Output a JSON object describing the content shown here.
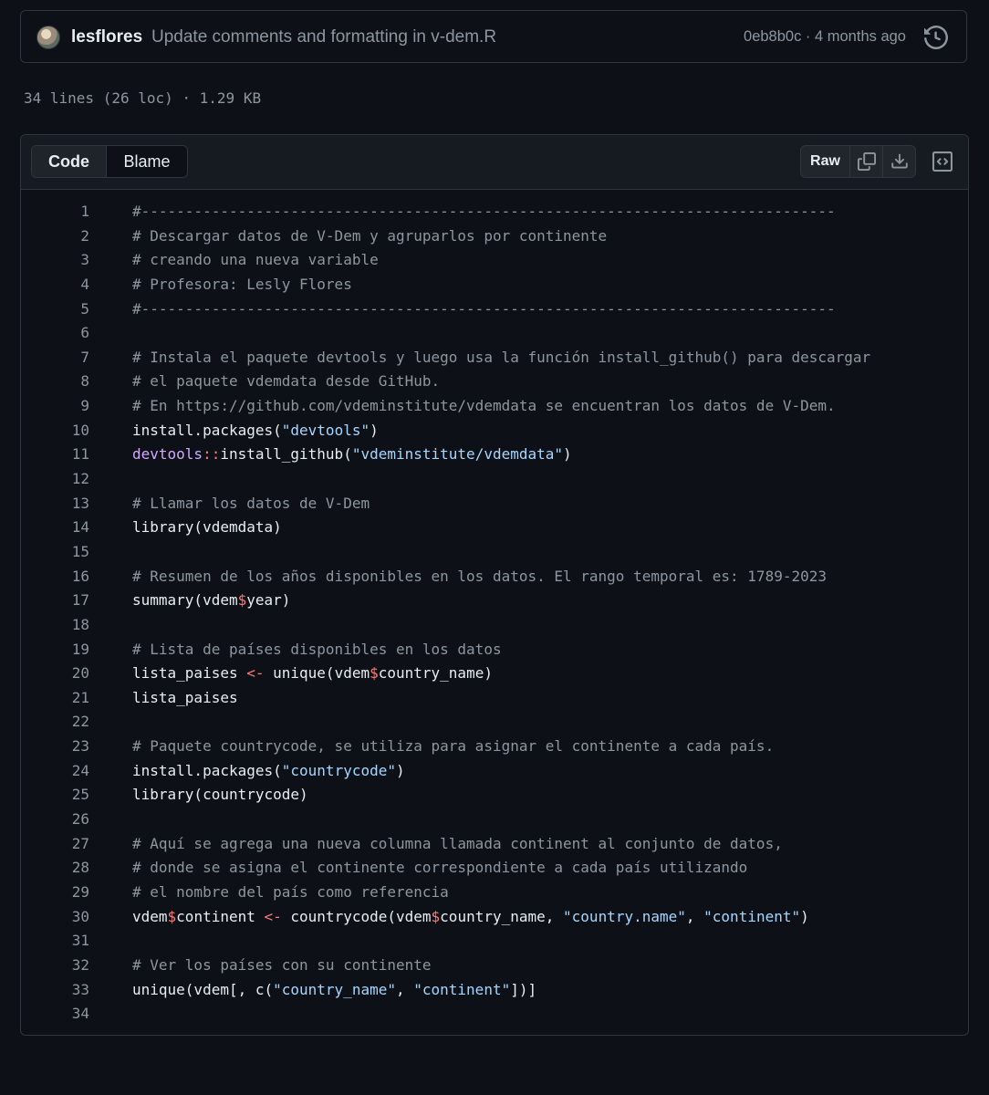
{
  "commit": {
    "author": "lesflores",
    "message": "Update comments and formatting in v-dem.R",
    "hash_time": "0eb8b0c · 4 months ago"
  },
  "file_info": "34 lines (26 loc) · 1.29 KB",
  "toolbar": {
    "tabs": [
      {
        "label": "Code",
        "active": true
      },
      {
        "label": "Blame",
        "active": false
      }
    ],
    "raw_label": "Raw",
    "icons": [
      "copy-icon",
      "download-icon",
      "code-square-icon"
    ]
  },
  "colors": {
    "comment": "#8d96a0",
    "string": "#a5d6ff",
    "operator": "#ff7b72",
    "namespace": "#d2a8ff",
    "background": "#0d1117"
  },
  "code_lines": [
    [
      [
        "c",
        "#-------------------------------------------------------------------------------"
      ]
    ],
    [
      [
        "c",
        "# Descargar datos de V-Dem y agruparlos por continente"
      ]
    ],
    [
      [
        "c",
        "# creando una nueva variable"
      ]
    ],
    [
      [
        "c",
        "# Profesora: Lesly Flores"
      ]
    ],
    [
      [
        "c",
        "#-------------------------------------------------------------------------------"
      ]
    ],
    [],
    [
      [
        "c",
        "# Instala el paquete devtools y luego usa la función install_github() para descargar"
      ]
    ],
    [
      [
        "c",
        "# el paquete vdemdata desde GitHub."
      ]
    ],
    [
      [
        "c",
        "# En https://github.com/vdeminstitute/vdemdata se encuentran los datos de V-Dem."
      ]
    ],
    [
      [
        "t",
        "install.packages("
      ],
      [
        "s",
        "\"devtools\""
      ],
      [
        "t",
        ")"
      ]
    ],
    [
      [
        "n",
        "devtools"
      ],
      [
        "o",
        "::"
      ],
      [
        "t",
        "install_github("
      ],
      [
        "s",
        "\"vdeminstitute/vdemdata\""
      ],
      [
        "t",
        ")"
      ]
    ],
    [],
    [
      [
        "c",
        "# Llamar los datos de V-Dem"
      ]
    ],
    [
      [
        "t",
        "library(vdemdata)"
      ]
    ],
    [],
    [
      [
        "c",
        "# Resumen de los años disponibles en los datos. El rango temporal es: 1789-2023"
      ]
    ],
    [
      [
        "t",
        "summary(vdem"
      ],
      [
        "o",
        "$"
      ],
      [
        "t",
        "year)"
      ]
    ],
    [],
    [
      [
        "c",
        "# Lista de países disponibles en los datos"
      ]
    ],
    [
      [
        "t",
        "lista_paises "
      ],
      [
        "o",
        "<-"
      ],
      [
        "t",
        " unique(vdem"
      ],
      [
        "o",
        "$"
      ],
      [
        "t",
        "country_name)"
      ]
    ],
    [
      [
        "t",
        "lista_paises"
      ]
    ],
    [],
    [
      [
        "c",
        "# Paquete countrycode, se utiliza para asignar el continente a cada país."
      ]
    ],
    [
      [
        "t",
        "install.packages("
      ],
      [
        "s",
        "\"countrycode\""
      ],
      [
        "t",
        ")"
      ]
    ],
    [
      [
        "t",
        "library(countrycode)"
      ]
    ],
    [],
    [
      [
        "c",
        "# Aquí se agrega una nueva columna llamada continent al conjunto de datos,"
      ]
    ],
    [
      [
        "c",
        "# donde se asigna el continente correspondiente a cada país utilizando"
      ]
    ],
    [
      [
        "c",
        "# el nombre del país como referencia"
      ]
    ],
    [
      [
        "t",
        "vdem"
      ],
      [
        "o",
        "$"
      ],
      [
        "t",
        "continent "
      ],
      [
        "o",
        "<-"
      ],
      [
        "t",
        " countrycode(vdem"
      ],
      [
        "o",
        "$"
      ],
      [
        "t",
        "country_name, "
      ],
      [
        "s",
        "\"country.name\""
      ],
      [
        "t",
        ", "
      ],
      [
        "s",
        "\"continent\""
      ],
      [
        "t",
        ")"
      ]
    ],
    [],
    [
      [
        "c",
        "# Ver los países con su continente"
      ]
    ],
    [
      [
        "t",
        "unique(vdem[, c("
      ],
      [
        "s",
        "\"country_name\""
      ],
      [
        "t",
        ", "
      ],
      [
        "s",
        "\"continent\""
      ],
      [
        "t",
        "])]"
      ]
    ],
    []
  ]
}
